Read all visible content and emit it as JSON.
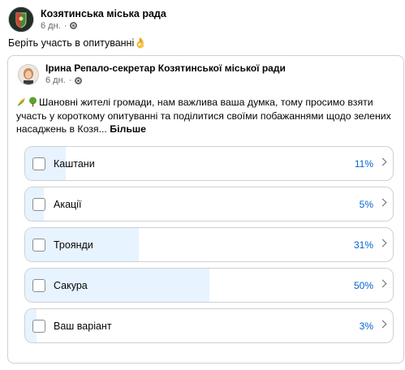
{
  "header": {
    "page_name": "Козятинська міська рада",
    "time": "6 дн.",
    "privacy_icon": "globe-icon"
  },
  "post": {
    "text": "Беріть участь в опитуванні👌"
  },
  "shared": {
    "author": "Ірина Репало-секретар Козятинської міської ради",
    "time": "6 дн.",
    "privacy_icon": "globe-icon",
    "text": "Шановні жителі громади, нам важлива ваша думка, тому просимо взяти участь у короткому опитуванні та поділитися своїми побажаннями щодо зелених насаджень в Козя...",
    "more_label": "Більше",
    "emoji_icons": [
      "ear-of-corn-icon",
      "deciduous-tree-icon"
    ]
  },
  "poll": {
    "options": [
      {
        "label": "Каштани",
        "percent_text": "11%",
        "percent": 11
      },
      {
        "label": "Акації",
        "percent_text": "5%",
        "percent": 5
      },
      {
        "label": "Троянди",
        "percent_text": "31%",
        "percent": 31
      },
      {
        "label": "Сакура",
        "percent_text": "50%",
        "percent": 50
      },
      {
        "label": "Ваш варіант",
        "percent_text": "3%",
        "percent": 3
      }
    ]
  },
  "colors": {
    "accent": "#0064d1",
    "bar_fill": "#e7f3ff",
    "border": "#ced0d4",
    "secondary_text": "#65676b"
  }
}
